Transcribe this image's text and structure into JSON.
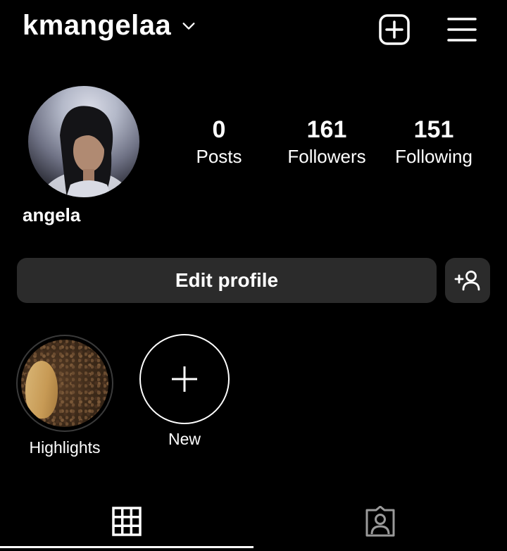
{
  "header": {
    "username": "kmangelaa",
    "icons": {
      "create": "add-post-icon",
      "menu": "hamburger-menu-icon",
      "account_switch": "chevron-down-icon"
    }
  },
  "profile": {
    "display_name": "angela",
    "stats": [
      {
        "count": "0",
        "label": "Posts"
      },
      {
        "count": "161",
        "label": "Followers"
      },
      {
        "count": "151",
        "label": "Following"
      }
    ]
  },
  "actions": {
    "edit_profile_label": "Edit profile",
    "discover_people_icon": "add-person-icon"
  },
  "highlights": [
    {
      "label": "Highlights"
    },
    {
      "label": "New"
    }
  ],
  "tabs": [
    {
      "name": "grid",
      "icon": "grid-icon",
      "selected": true
    },
    {
      "name": "tagged",
      "icon": "tagged-person-icon",
      "selected": false
    }
  ],
  "colors": {
    "background": "#000000",
    "button": "#2b2b2b",
    "text": "#ffffff"
  }
}
